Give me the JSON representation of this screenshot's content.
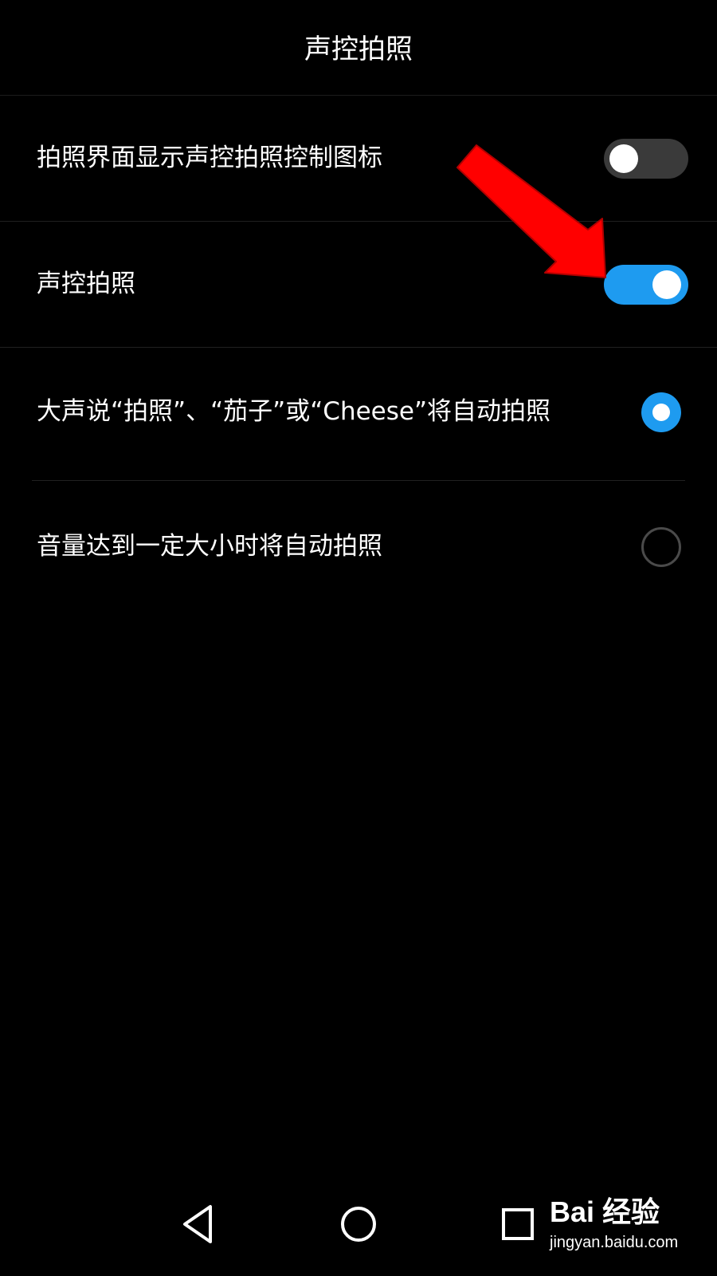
{
  "header": {
    "title": "声控拍照"
  },
  "settings": {
    "show_icon": {
      "label": "拍照界面显示声控拍照控制图标",
      "enabled": false
    },
    "voice_capture": {
      "label": "声控拍照",
      "enabled": true
    }
  },
  "options": [
    {
      "label": "大声说“拍照”、“茄子”或“Cheese”将自动拍照",
      "selected": true
    },
    {
      "label": "音量达到一定大小时将自动拍照",
      "selected": false
    }
  ],
  "colors": {
    "accent": "#1e9bf0",
    "background": "#000000",
    "switch_off": "#3a3a3a",
    "annotation_arrow": "#ff0000"
  },
  "navigation": {
    "icons": [
      "back-icon",
      "home-icon",
      "recents-icon"
    ]
  },
  "watermark": {
    "logo": "Bai 经验",
    "url": "jingyan.baidu.com"
  }
}
